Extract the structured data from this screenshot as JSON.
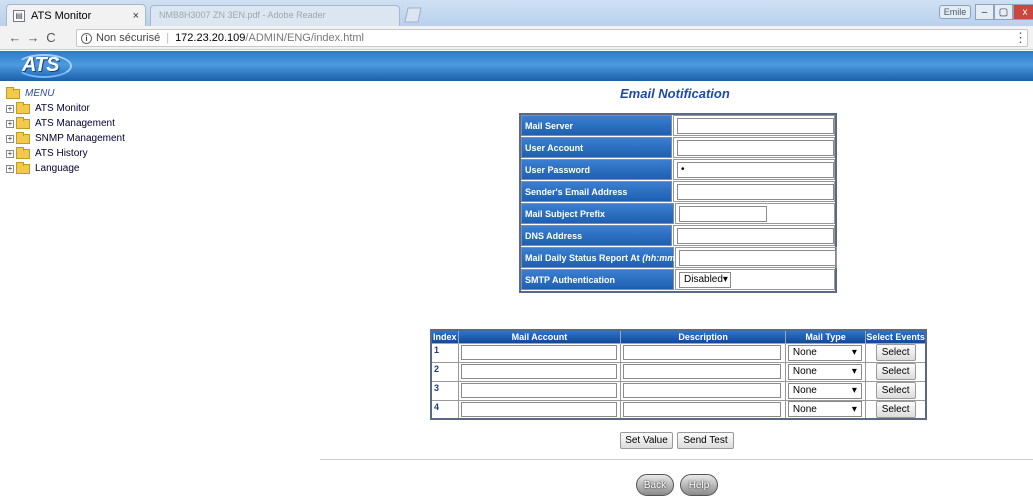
{
  "browser": {
    "tab_active_title": "ATS Monitor",
    "tab_close": "×",
    "tab_inactive_title": "NMB8H3007 ZN 3EN.pdf - Adobe Reader",
    "win_user": "Emile",
    "win_min": "–",
    "win_max": "▢",
    "win_close": "x",
    "nav_back": "←",
    "nav_forward": "→",
    "nav_reload": "C",
    "security_label": "Non sécurisé",
    "url_host": "172.23.20.109",
    "url_path": "/ADMIN/ENG/index.html"
  },
  "banner": {
    "logo": "ATS"
  },
  "menu": {
    "root": "MENU",
    "items": [
      "ATS Monitor",
      "ATS Management",
      "SNMP Management",
      "ATS History",
      "Language"
    ]
  },
  "page": {
    "title": "Email Notification"
  },
  "form": {
    "mail_server": {
      "label": "Mail Server",
      "value": ""
    },
    "user_account": {
      "label": "User Account",
      "value": ""
    },
    "user_password": {
      "label": "User Password",
      "value": "•"
    },
    "sender_email": {
      "label": "Sender's Email Address",
      "value": ""
    },
    "subject_prefix": {
      "label": "Mail Subject Prefix",
      "value": ""
    },
    "dns_address": {
      "label": "DNS Address",
      "value": ""
    },
    "daily_report": {
      "label": "Mail Daily Status Report At",
      "label_suffix": "(hh:mm)",
      "value": ""
    },
    "smtp_auth": {
      "label": "SMTP Authentication",
      "value": "Disabled"
    }
  },
  "grid": {
    "headers": {
      "index": "Index",
      "account": "Mail Account",
      "description": "Description",
      "type": "Mail Type",
      "events": "Select Events"
    },
    "rows": [
      {
        "index": "1",
        "type": "None",
        "select": "Select"
      },
      {
        "index": "2",
        "type": "None",
        "select": "Select"
      },
      {
        "index": "3",
        "type": "None",
        "select": "Select"
      },
      {
        "index": "4",
        "type": "None",
        "select": "Select"
      }
    ]
  },
  "actions": {
    "set_value": "Set Value",
    "send_test": "Send Test",
    "back": "Back",
    "help": "Help"
  }
}
